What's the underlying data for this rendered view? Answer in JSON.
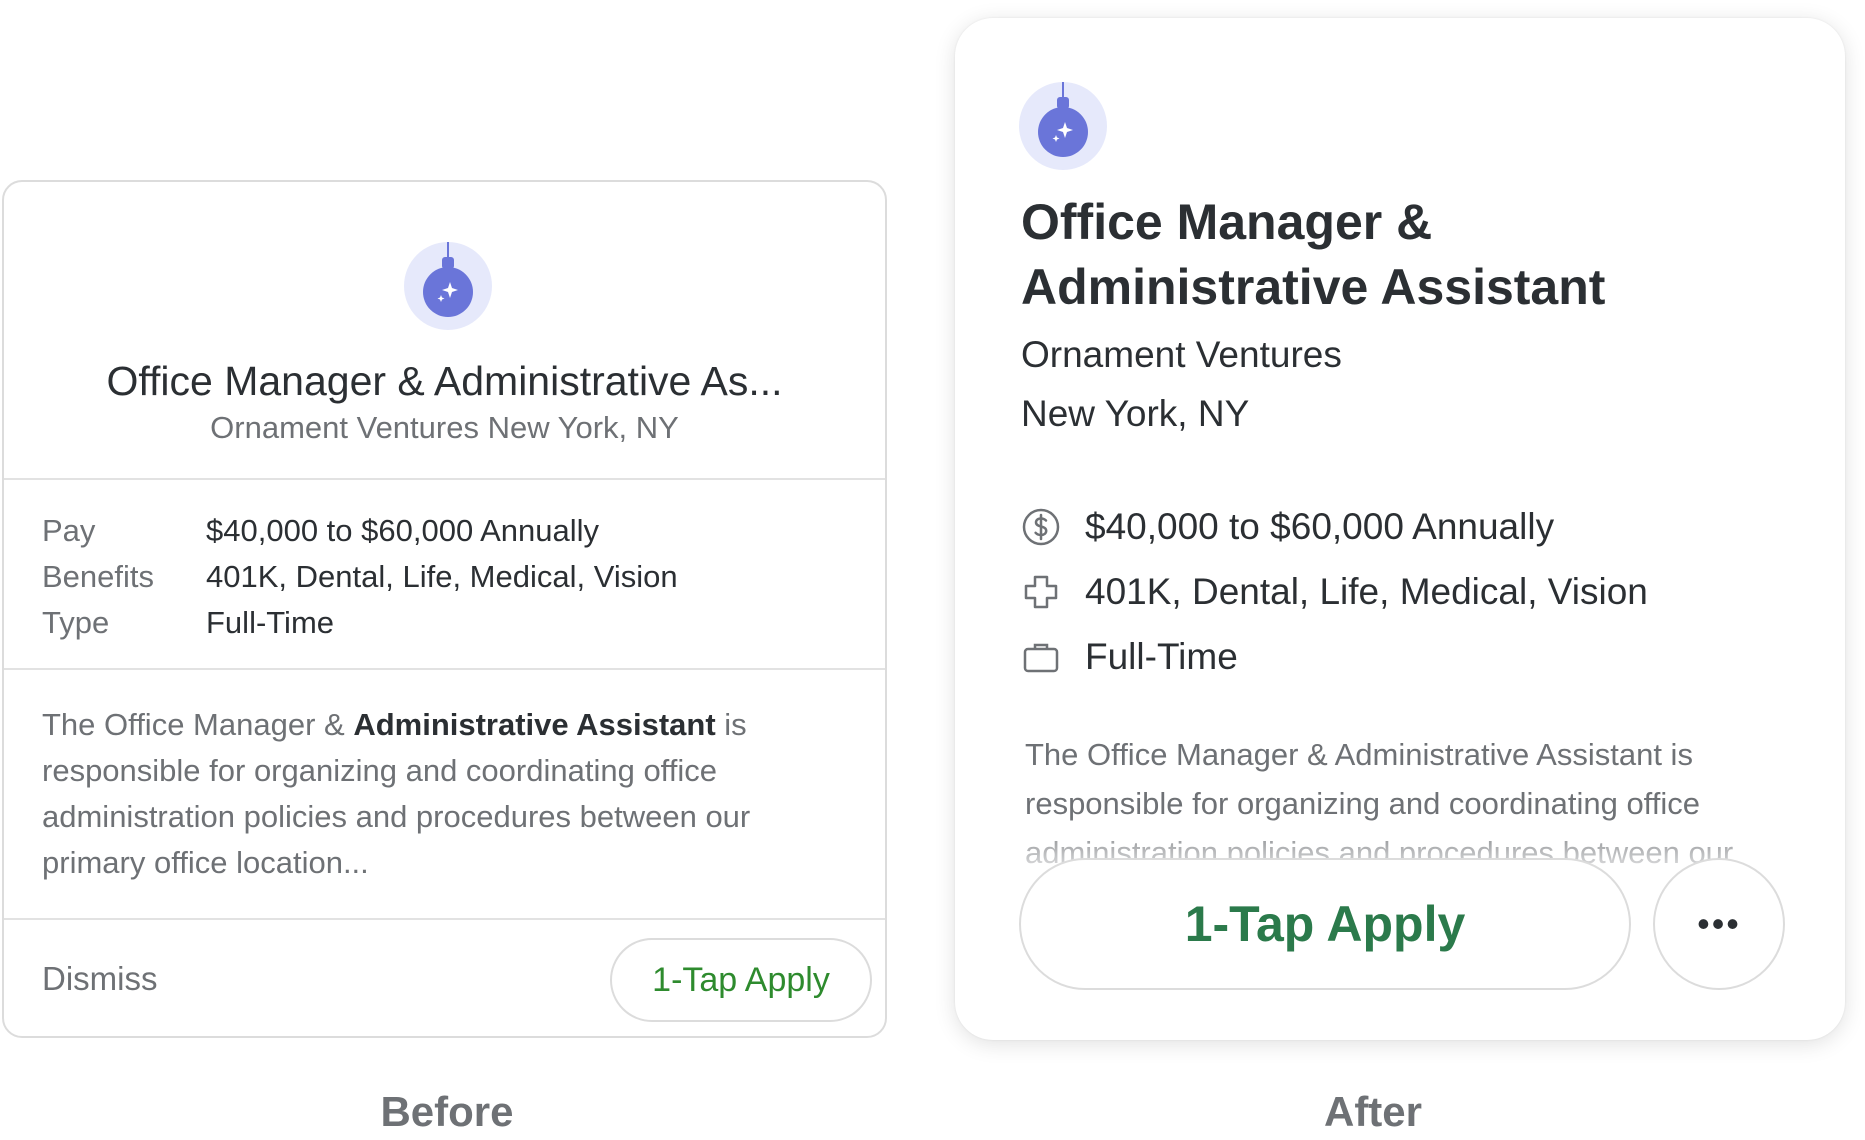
{
  "before": {
    "logo_icon": "ornament-ball-icon",
    "job_title": "Office Manager & Administrative As...",
    "company_location": "Ornament Ventures New York, NY",
    "details": [
      {
        "label": "Pay",
        "value": "$40,000 to $60,000 Annually"
      },
      {
        "label": "Benefits",
        "value": "401K, Dental, Life, Medical, Vision"
      },
      {
        "label": "Type",
        "value": "Full-Time"
      }
    ],
    "description_prefix": "The Office Manager & ",
    "description_bold": "Administrative Assistant",
    "description_suffix": " is responsible for organizing and coordinating office administration policies and procedures between our primary office location...",
    "dismiss_label": "Dismiss",
    "apply_label": "1-Tap Apply"
  },
  "after": {
    "logo_icon": "ornament-ball-icon",
    "job_title_line1": "Office Manager &",
    "job_title_line2": "Administrative Assistant",
    "company": "Ornament Ventures",
    "location": "New York, NY",
    "pay": "$40,000 to $60,000 Annually",
    "pay_icon": "dollar-circle-icon",
    "benefits": "401K, Dental, Life, Medical, Vision",
    "benefits_icon": "medical-cross-icon",
    "type": "Full-Time",
    "type_icon": "briefcase-icon",
    "description": "The Office Manager & Administrative Assistant is responsible for organizing and coordinating office administration policies and procedures between our primary office locations, and...",
    "apply_label": "1-Tap Apply",
    "more_label": "•••",
    "more_icon": "more-dots-icon"
  },
  "captions": {
    "before": "Before",
    "after": "After"
  },
  "colors": {
    "apply_green_before": "#2e8b2e",
    "apply_green_after": "#2b7a4b",
    "logo_purple": "#6a75d9",
    "logo_bg": "#e6e9fb"
  }
}
